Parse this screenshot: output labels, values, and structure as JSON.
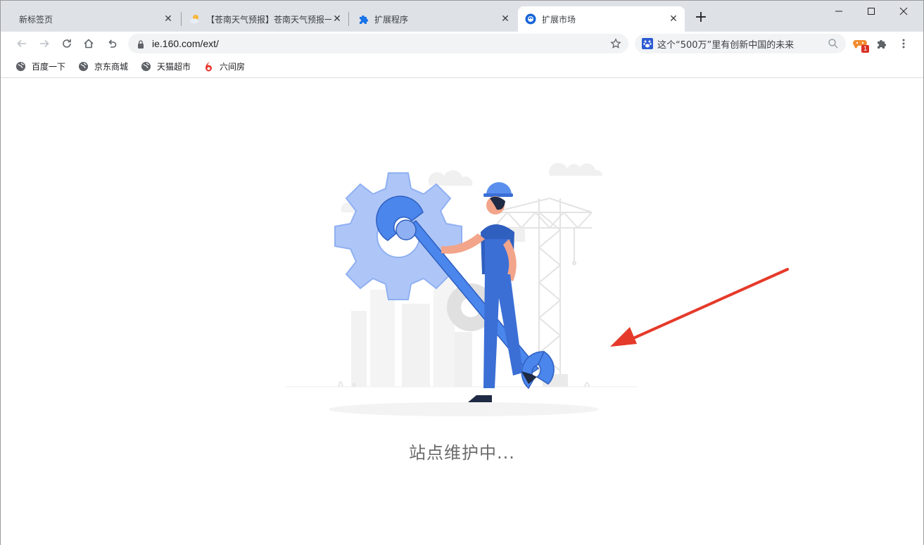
{
  "tabs": [
    {
      "title": "新标签页",
      "icon": "none",
      "active": false
    },
    {
      "title": "【苍南天气预报】苍南天气预报一",
      "icon": "weather-icon",
      "active": false
    },
    {
      "title": "扩展程序",
      "icon": "puzzle-icon",
      "active": false
    },
    {
      "title": "扩展市场",
      "icon": "browser-logo-icon",
      "active": true
    }
  ],
  "toolbar": {
    "url": "ie.160.com/ext/",
    "search_query": "这个“500万”里有创新中国的未来",
    "extension_badge": "1"
  },
  "bookmarks": [
    {
      "label": "百度一下",
      "icon": "globe-icon"
    },
    {
      "label": "京东商城",
      "icon": "globe-icon"
    },
    {
      "label": "天猫超市",
      "icon": "globe-icon"
    },
    {
      "label": "六间房",
      "icon": "six-room-icon"
    }
  ],
  "content": {
    "message": "站点维护中..."
  },
  "colors": {
    "accent_blue": "#3b6fd6",
    "light_blue": "#aec6f7",
    "arrow_red": "#e53a2a"
  }
}
